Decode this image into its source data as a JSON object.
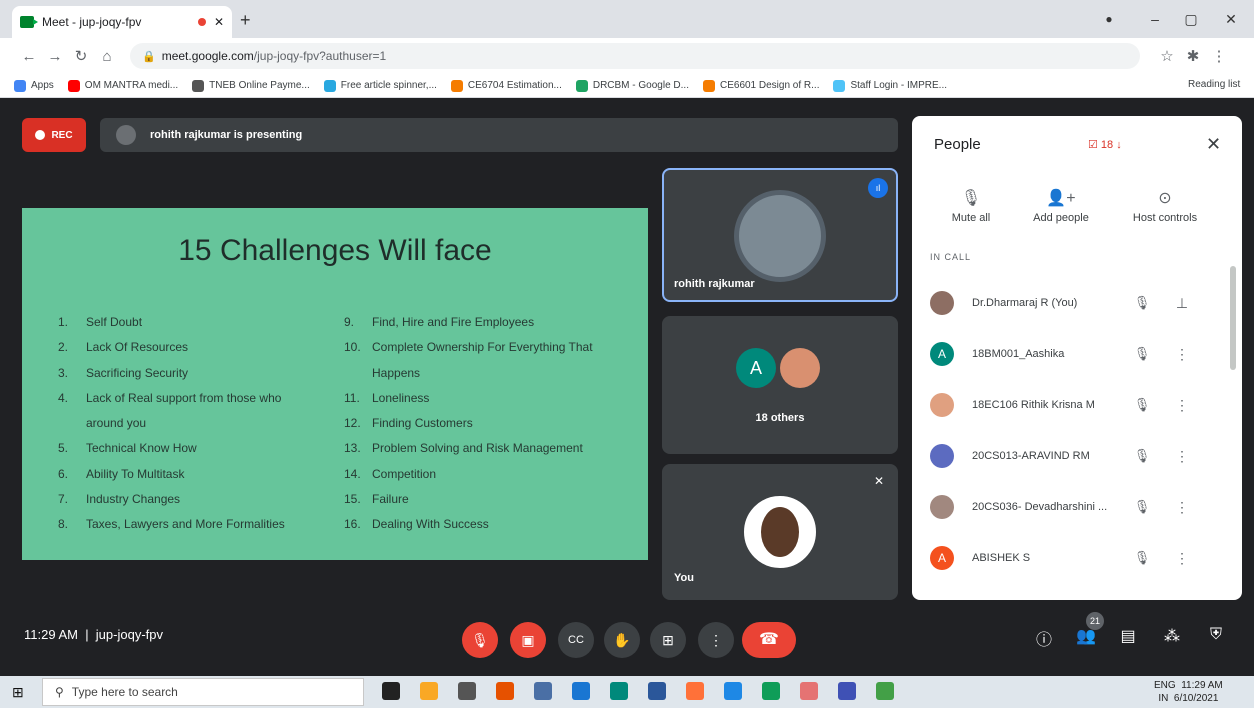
{
  "browser": {
    "tab_title": "Meet - jup-joqy-fpv",
    "url_host": "meet.google.com",
    "url_path": "/jup-joqy-fpv?authuser=1",
    "bookmarks": [
      {
        "label": "Apps",
        "color": "#4285f4"
      },
      {
        "label": "OM MANTRA medi...",
        "color": "#ff0000"
      },
      {
        "label": "TNEB Online Payme...",
        "color": "#555"
      },
      {
        "label": "Free article spinner,...",
        "color": "#29a8e0"
      },
      {
        "label": "CE6704 Estimation...",
        "color": "#f57c00"
      },
      {
        "label": "DRCBM - Google D...",
        "color": "#1fa463"
      },
      {
        "label": "CE6601 Design of R...",
        "color": "#f57c00"
      },
      {
        "label": "Staff Login - IMPRE...",
        "color": "#4fc3f7"
      }
    ],
    "reading_list": "Reading list"
  },
  "meet": {
    "rec_label": "REC",
    "presenting": "rohith rajkumar is presenting",
    "meeting_time": "11:29 AM",
    "meeting_code": "jup-joqy-fpv",
    "people_count": "21"
  },
  "slide": {
    "title": "15 Challenges Will face",
    "left": [
      [
        "1.",
        "Self Doubt"
      ],
      [
        "2.",
        "Lack Of Resources"
      ],
      [
        "3.",
        "Sacrificing Security"
      ],
      [
        "4.",
        "Lack of Real support from those who"
      ],
      [
        "",
        "around you"
      ],
      [
        "5.",
        "Technical Know How"
      ],
      [
        "6.",
        "Ability To Multitask"
      ],
      [
        "7.",
        "Industry Changes"
      ],
      [
        "8.",
        "Taxes, Lawyers and More Formalities"
      ]
    ],
    "right": [
      [
        "9.",
        "Find, Hire and Fire Employees"
      ],
      [
        "10.",
        "Complete Ownership For Everything That"
      ],
      [
        "",
        "Happens"
      ],
      [
        "11.",
        "Loneliness"
      ],
      [
        "12.",
        "Finding Customers"
      ],
      [
        "13.",
        "Problem Solving and Risk Management"
      ],
      [
        "14.",
        "Competition"
      ],
      [
        "15.",
        "Failure"
      ],
      [
        "16.",
        "Dealing With Success"
      ]
    ]
  },
  "tiles": {
    "presenter": "rohith rajkumar",
    "others_initial": "A",
    "others": "18 others",
    "self": "You"
  },
  "people": {
    "title": "People",
    "badge": "18",
    "mute_all": "Mute all",
    "add_people": "Add people",
    "host_controls": "Host controls",
    "in_call": "IN CALL",
    "list": [
      {
        "name": "Dr.Dharmaraj R (You)",
        "initial": "",
        "color": "#8d6e63"
      },
      {
        "name": "18BM001_Aashika",
        "initial": "A",
        "color": "#00897b"
      },
      {
        "name": "18EC106 Rithik Krisna M",
        "initial": "",
        "color": "#e0a080"
      },
      {
        "name": "20CS013-ARAVIND RM",
        "initial": "",
        "color": "#5c6bc0"
      },
      {
        "name": "20CS036- Devadharshini ...",
        "initial": "",
        "color": "#a1887f"
      },
      {
        "name": "ABISHEK S",
        "initial": "A",
        "color": "#f4511e"
      }
    ]
  },
  "taskbar": {
    "search": "Type here to search",
    "lang1": "ENG",
    "lang2": "IN",
    "time": "11:29 AM",
    "date": "6/10/2021"
  }
}
